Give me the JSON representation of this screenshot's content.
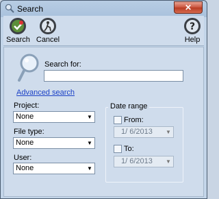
{
  "window": {
    "title": "Search",
    "close_label": "✕"
  },
  "toolbar": {
    "search_label": "Search",
    "cancel_label": "Cancel",
    "help_label": "Help"
  },
  "search": {
    "label": "Search for:",
    "value": "",
    "advanced_link": "Advanced search"
  },
  "project": {
    "label": "Project:",
    "value": "None"
  },
  "file_type": {
    "label": "File type:",
    "value": "None"
  },
  "user": {
    "label": "User:",
    "value": "None"
  },
  "date_range": {
    "title": "Date range",
    "from_label": "From:",
    "from_value": "1/ 6/2013",
    "to_label": "To:",
    "to_value": "1/ 6/2013"
  },
  "colors": {
    "accent": "#1a40c6",
    "window_bg": "#cfdcec",
    "close": "#c9523b"
  }
}
